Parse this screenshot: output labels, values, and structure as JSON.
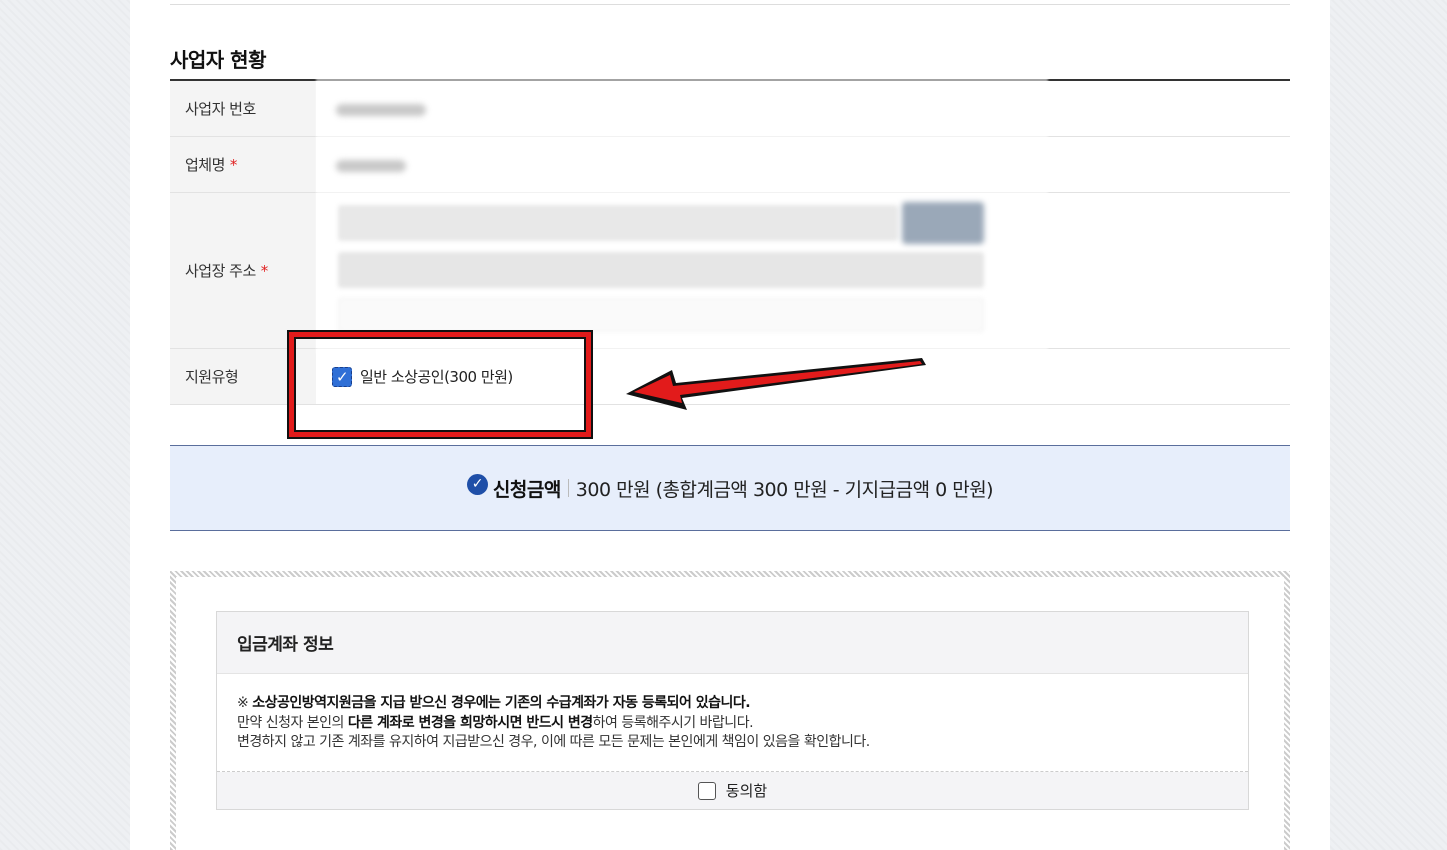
{
  "section": {
    "title": "사업자 현황"
  },
  "fields": {
    "business_number_label": "사업자 번호",
    "company_name_label": "업체명",
    "address_label": "사업장 주소",
    "support_type_label": "지원유형",
    "required_mark": "*"
  },
  "support_type": {
    "option_label": "일반 소상공인(300 만원)",
    "checked": true
  },
  "amount": {
    "label": "신청금액",
    "value": "300 만원 (총합계금액 300 만원 - 기지급금액 0 만원)"
  },
  "account": {
    "title": "입금계좌 정보",
    "line1_prefix": "※ ",
    "line1_bold": "소상공인방역지원금을 지급 받으신 경우에는 기존의 수급계좌가 자동 등록되어 있습니다.",
    "line2_a": "만약 신청자 본인의 ",
    "line2_b": "다른 계좌로 변경을 희망하시면 반드시 변경",
    "line2_c": "하여 등록해주시기 바랍니다.",
    "line3": "변경하지 않고 기존 계좌를 유지하여 지급받으신 경우, 이에 따른 모든 문제는 본인에게 책임이 있음을 확인합니다.",
    "agree_label": "동의함",
    "agree_checked": false
  },
  "colors": {
    "highlight_red": "#e21b1b",
    "checkbox_blue": "#2f6fd6",
    "amount_bg": "#e7eefb"
  }
}
